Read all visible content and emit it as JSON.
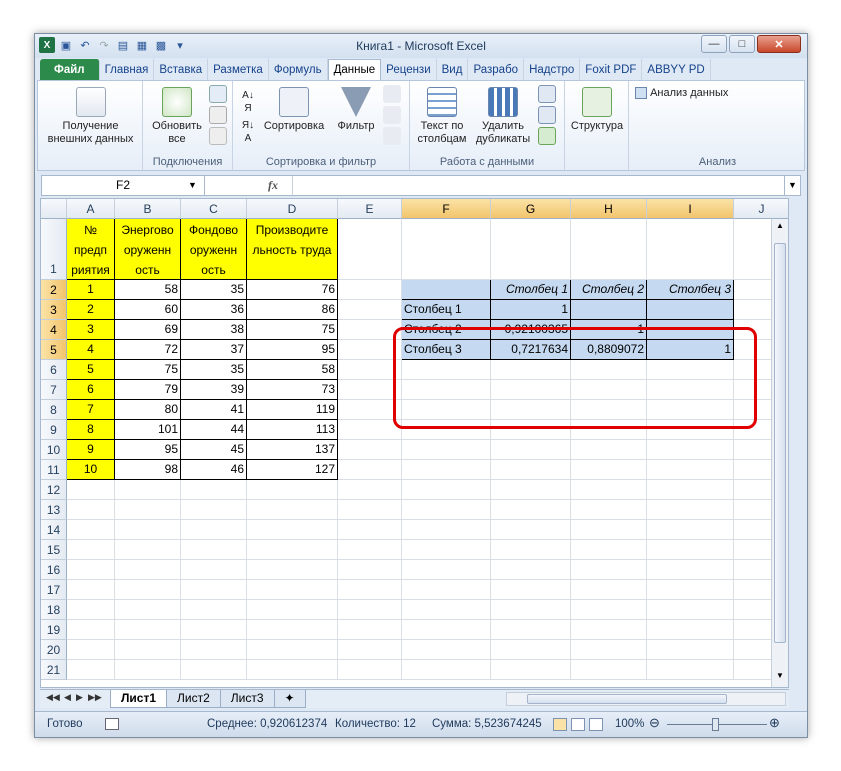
{
  "window": {
    "title": "Книга1 - Microsoft Excel"
  },
  "ribbon_tabs": [
    "Файл",
    "Главная",
    "Вставка",
    "Разметка",
    "Формуль",
    "Данные",
    "Рецензи",
    "Вид",
    "Разрабо",
    "Надстро",
    "Foxit PDF",
    "ABBYY PD"
  ],
  "ribbon": {
    "get_external": "Получение внешних данных",
    "refresh_all": "Обновить все",
    "connections_group": "Подключения",
    "sort": "Сортировка",
    "filter": "Фильтр",
    "sort_filter_group": "Сортировка и фильтр",
    "text_to_columns": "Текст по столбцам",
    "remove_dupes": "Удалить дубликаты",
    "data_tools_group": "Работа с данными",
    "outline": "Структура",
    "data_analysis": "Анализ данных",
    "analysis_group": "Анализ"
  },
  "formula_bar": {
    "name_box": "F2",
    "fx": "fx",
    "value": ""
  },
  "columns": [
    "A",
    "B",
    "C",
    "D",
    "E",
    "F",
    "G",
    "H",
    "I",
    "J"
  ],
  "rows": [
    "1",
    "2",
    "3",
    "4",
    "5",
    "6",
    "7",
    "8",
    "9",
    "10",
    "11",
    "12",
    "13",
    "14",
    "15",
    "16",
    "17",
    "18",
    "19",
    "20",
    "21"
  ],
  "table": {
    "headers": [
      "№ предп риятия",
      "Энергово оруженн ость",
      "Фондово оруженн ость",
      "Производите льность труда"
    ],
    "rows": [
      [
        "1",
        "58",
        "35",
        "76"
      ],
      [
        "2",
        "60",
        "36",
        "86"
      ],
      [
        "3",
        "69",
        "38",
        "75"
      ],
      [
        "4",
        "72",
        "37",
        "95"
      ],
      [
        "5",
        "75",
        "35",
        "58"
      ],
      [
        "6",
        "79",
        "39",
        "73"
      ],
      [
        "7",
        "80",
        "41",
        "119"
      ],
      [
        "8",
        "101",
        "44",
        "113"
      ],
      [
        "9",
        "95",
        "45",
        "137"
      ],
      [
        "10",
        "98",
        "46",
        "127"
      ]
    ]
  },
  "correlation": {
    "col_headers": [
      "Столбец 1",
      "Столбец 2",
      "Столбец 3"
    ],
    "rows": [
      {
        "label": "Столбец 1",
        "values": [
          "1",
          "",
          ""
        ]
      },
      {
        "label": "Столбец 2",
        "values": [
          "0,92100365",
          "1",
          ""
        ]
      },
      {
        "label": "Столбец 3",
        "values": [
          "0,7217634",
          "0,8809072",
          "1"
        ]
      }
    ]
  },
  "sheets": [
    "Лист1",
    "Лист2",
    "Лист3"
  ],
  "status": {
    "ready": "Готово",
    "average": "Среднее: 0,920612374",
    "count": "Количество: 12",
    "sum": "Сумма: 5,523674245",
    "zoom": "100%"
  }
}
